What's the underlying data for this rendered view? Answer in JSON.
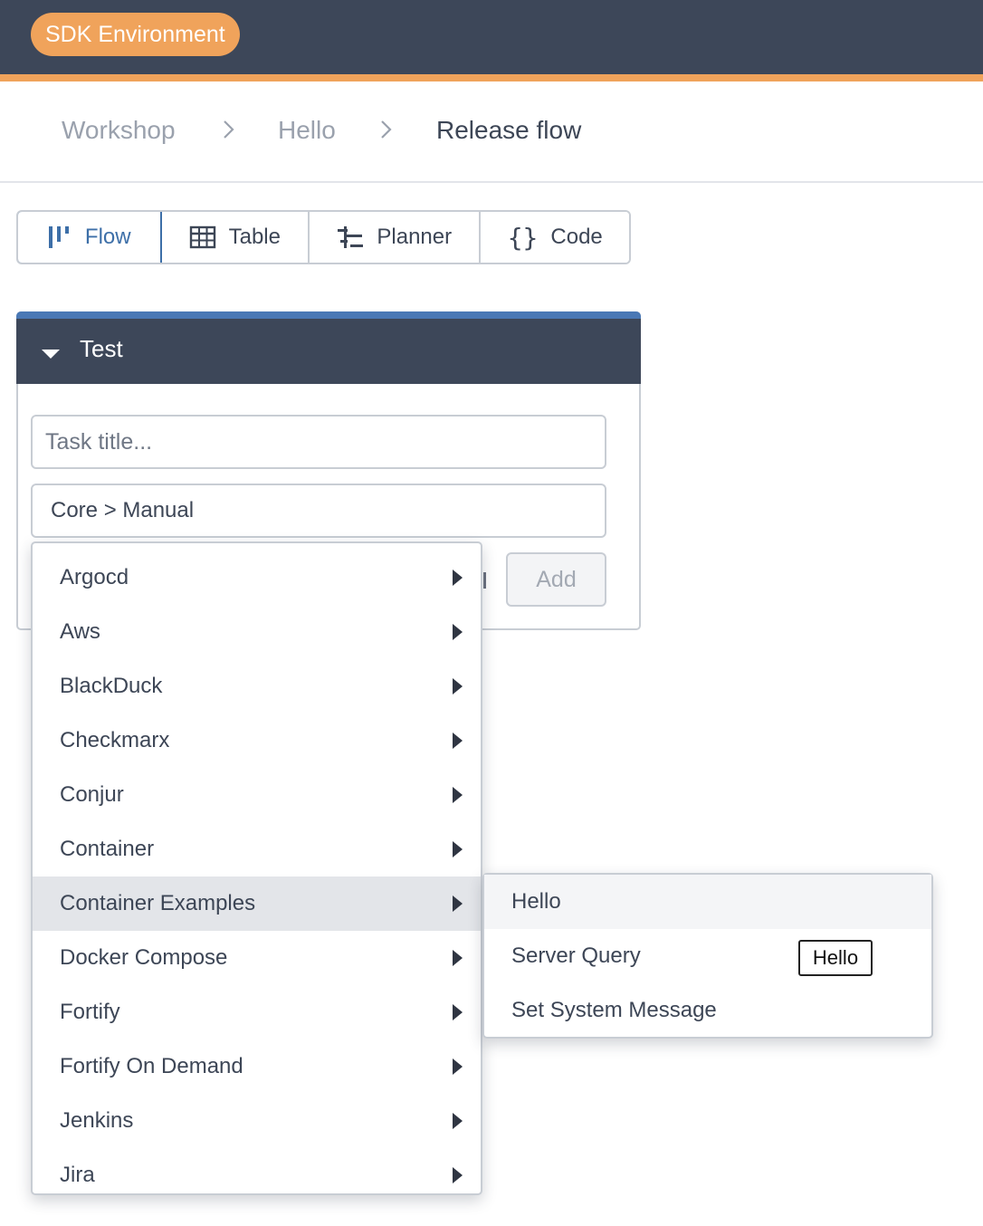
{
  "env_badge": "SDK Environment",
  "colors": {
    "header_bg": "#3d4759",
    "accent": "#f0a35b",
    "primary": "#3d6fa8",
    "phase_top": "#4a78b5"
  },
  "breadcrumb": {
    "items": [
      "Workshop",
      "Hello",
      "Release flow"
    ],
    "separator_icon": "chevron-right-icon"
  },
  "view_tabs": [
    {
      "label": "Flow",
      "icon": "flow-icon",
      "active": true
    },
    {
      "label": "Table",
      "icon": "table-icon",
      "active": false
    },
    {
      "label": "Planner",
      "icon": "planner-icon",
      "active": false
    },
    {
      "label": "Code",
      "icon": "code-braces-icon",
      "active": false
    }
  ],
  "phase": {
    "title": "Test",
    "expanded": true
  },
  "task_form": {
    "title_placeholder": "Task title...",
    "task_type": "Core > Manual",
    "add_label": "Add"
  },
  "type_menu": {
    "items": [
      "Argocd",
      "Aws",
      "BlackDuck",
      "Checkmarx",
      "Conjur",
      "Container",
      "Container Examples",
      "Docker Compose",
      "Fortify",
      "Fortify On Demand",
      "Jenkins",
      "Jira"
    ],
    "highlighted": "Container Examples"
  },
  "submenu": {
    "items": [
      "Hello",
      "Server Query",
      "Set System Message"
    ],
    "highlighted": "Hello"
  },
  "tooltip": "Hello"
}
